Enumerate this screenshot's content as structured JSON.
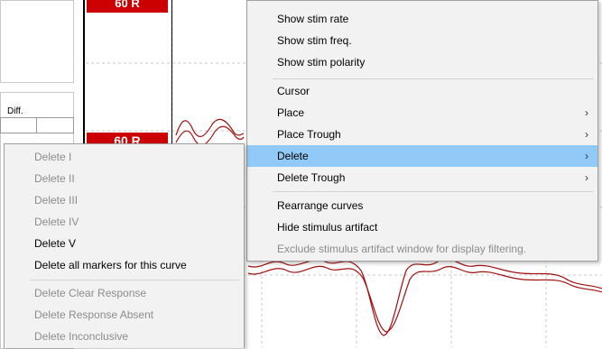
{
  "left_panel": {
    "diff_label": "Diff.",
    "red_labels": [
      "60 R",
      "60 R"
    ]
  },
  "context_menu": {
    "items": [
      {
        "label": "Show stim rate",
        "enabled": true
      },
      {
        "label": "Show stim freq.",
        "enabled": true
      },
      {
        "label": "Show stim polarity",
        "enabled": true
      },
      {
        "label": "Cursor",
        "enabled": true
      },
      {
        "label": "Place",
        "enabled": true,
        "submenu": true
      },
      {
        "label": "Place Trough",
        "enabled": true,
        "submenu": true
      },
      {
        "label": "Delete",
        "enabled": true,
        "submenu": true,
        "highlighted": true
      },
      {
        "label": "Delete Trough",
        "enabled": true,
        "submenu": true
      },
      {
        "label": "Rearrange curves",
        "enabled": true
      },
      {
        "label": "Hide stimulus artifact",
        "enabled": true
      },
      {
        "label": "Exclude stimulus artifact window for display filtering.",
        "enabled": false
      }
    ],
    "chevron": "›"
  },
  "delete_submenu": {
    "items": [
      {
        "label": "Delete I",
        "enabled": false
      },
      {
        "label": "Delete II",
        "enabled": false
      },
      {
        "label": "Delete III",
        "enabled": false
      },
      {
        "label": "Delete IV",
        "enabled": false
      },
      {
        "label": "Delete V",
        "enabled": true
      },
      {
        "label": "Delete all markers for this curve",
        "enabled": true
      },
      {
        "label": "Delete Clear Response",
        "enabled": false
      },
      {
        "label": "Delete Response Absent",
        "enabled": false
      },
      {
        "label": "Delete Inconclusive",
        "enabled": false
      }
    ]
  },
  "colors": {
    "menu_bg": "#f2f2f2",
    "highlight": "#91c9f7",
    "disabled_text": "#8c8c8c",
    "waveform": "#a01010",
    "label_red": "#cc0000"
  }
}
